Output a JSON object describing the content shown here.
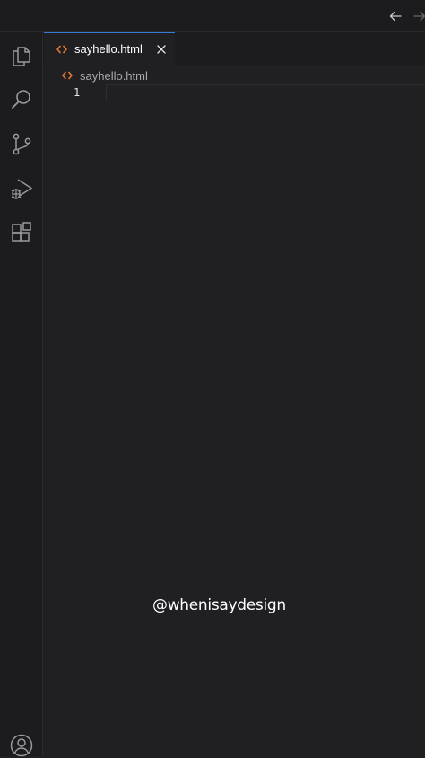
{
  "titlebar": {
    "back_icon": "arrow-left-icon",
    "forward_icon": "arrow-right-icon"
  },
  "activity_bar": {
    "items": [
      {
        "icon": "explorer-icon"
      },
      {
        "icon": "search-icon"
      },
      {
        "icon": "source-control-icon"
      },
      {
        "icon": "run-debug-icon"
      },
      {
        "icon": "extensions-icon"
      }
    ],
    "account_icon": "account-icon"
  },
  "tabs": [
    {
      "label": "sayhello.html",
      "icon": "html-file-icon",
      "active": true
    }
  ],
  "breadcrumb": {
    "file": "sayhello.html"
  },
  "editor": {
    "line_numbers": [
      "1"
    ]
  },
  "watermark": "@whenisaydesign",
  "colors": {
    "background": "#201f22",
    "accent": "#3a7bd5",
    "html_icon": "#e37933"
  }
}
